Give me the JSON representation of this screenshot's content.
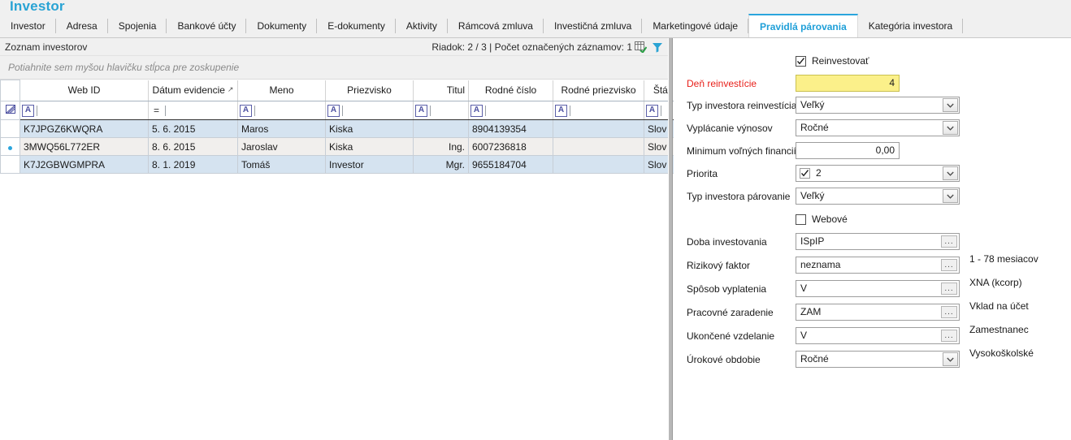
{
  "app": {
    "title": "Investor"
  },
  "tabs": [
    {
      "label": "Investor",
      "active": false
    },
    {
      "label": "Adresa",
      "active": false
    },
    {
      "label": "Spojenia",
      "active": false
    },
    {
      "label": "Bankové účty",
      "active": false
    },
    {
      "label": "Dokumenty",
      "active": false
    },
    {
      "label": "E-dokumenty",
      "active": false
    },
    {
      "label": "Aktivity",
      "active": false
    },
    {
      "label": "Rámcová zmluva",
      "active": false
    },
    {
      "label": "Investičná zmluva",
      "active": false
    },
    {
      "label": "Marketingové údaje",
      "active": false
    },
    {
      "label": "Pravidlá párovania",
      "active": true
    },
    {
      "label": "Kategória investora",
      "active": false
    }
  ],
  "grid": {
    "caption": "Zoznam investorov",
    "row_info": "Riadok: 2 / 3 | Počet označených záznamov: 1",
    "group_hint": "Potiahnite sem myšou hlavičku stĺpca pre zoskupenie",
    "columns": [
      {
        "label": "Web ID",
        "align": "center",
        "filter": "A"
      },
      {
        "label": "Dátum evidencie",
        "align": "center",
        "sorted": "asc",
        "filter": "="
      },
      {
        "label": "Meno",
        "align": "center",
        "filter": "A"
      },
      {
        "label": "Priezvisko",
        "align": "center",
        "filter": "A"
      },
      {
        "label": "Titul",
        "align": "right",
        "filter": "A"
      },
      {
        "label": "Rodné číslo",
        "align": "center",
        "filter": "A"
      },
      {
        "label": "Rodné priezvisko",
        "align": "center",
        "filter": "A"
      },
      {
        "label": "Štát",
        "align": "center",
        "filter": "A"
      }
    ],
    "rows": [
      {
        "selected": false,
        "cells": [
          "K7JPGZ6KWQRA",
          "5. 6. 2015",
          "Maros",
          "Kiska",
          "",
          "8904139354",
          "",
          "Slov"
        ]
      },
      {
        "selected": true,
        "cells": [
          "3MWQ56L772ER",
          "8. 6. 2015",
          "Jaroslav",
          "Kiska",
          "Ing.",
          "6007236818",
          "",
          "Slov"
        ]
      },
      {
        "selected": false,
        "cells": [
          "K7J2GBWGMPRA",
          "8. 1. 2019",
          "Tomáš",
          "Investor",
          "Mgr.",
          "9655184704",
          "",
          "Slov"
        ]
      }
    ]
  },
  "form": {
    "reinvestovat": {
      "label": "Reinvestovať",
      "checked": true
    },
    "fields": [
      {
        "label": "Deň reinvestície",
        "value": "4",
        "kind": "yellow-number",
        "required": true
      },
      {
        "label": "Typ investora reinvestícia",
        "value": "Veľký",
        "kind": "combo"
      },
      {
        "label": "Vyplácanie výnosov",
        "value": "Ročné",
        "kind": "combo"
      },
      {
        "label": "Minimum voľných financií",
        "value": "0,00",
        "kind": "number"
      },
      {
        "label": "Priorita",
        "value": "2",
        "kind": "combo-check",
        "checked": true
      },
      {
        "label": "Typ investora párovanie",
        "value": "Veľký",
        "kind": "combo"
      }
    ],
    "webove": {
      "label": "Webové",
      "checked": false
    },
    "lookups": [
      {
        "label": "Doba investovania",
        "value": "ISpIP",
        "desc": "1 - 78 mesiacov"
      },
      {
        "label": "Rizikový faktor",
        "value": "neznama",
        "desc": "XNA (kcorp)"
      },
      {
        "label": "Spôsob vyplatenia",
        "value": "V",
        "desc": "Vklad na účet"
      },
      {
        "label": "Pracovné zaradenie",
        "value": "ZAM",
        "desc": "Zamestnanec"
      },
      {
        "label": "Ukončené vzdelanie",
        "value": "V",
        "desc": "Vysokoškolské"
      }
    ],
    "last": {
      "label": "Úrokové obdobie",
      "value": "Ročné",
      "kind": "combo"
    },
    "lookup_button_label": "..."
  },
  "colors": {
    "accent": "#2aa5dd",
    "required": "#e8201a",
    "highlight": "#fbf08a",
    "row_selected": "#d5e3f0"
  }
}
